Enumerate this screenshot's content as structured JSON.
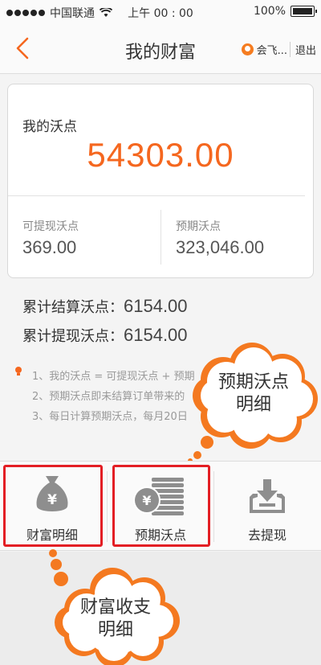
{
  "status_bar": {
    "carrier": "中国联通",
    "time": "上午 00 : 00",
    "battery": "100%"
  },
  "navbar": {
    "title": "我的财富",
    "user_name": "会飞...",
    "logout": "退出"
  },
  "wealth_card": {
    "label": "我的沃点",
    "total": "54303.00",
    "withdrawable_label": "可提现沃点",
    "withdrawable_value": "369.00",
    "expected_label": "预期沃点",
    "expected_value": "323,046.00"
  },
  "stats": {
    "settled_label": "累计结算沃点：",
    "settled_value": "6154.00",
    "withdrawn_label": "累计提现沃点：",
    "withdrawn_value": "6154.00"
  },
  "notes": [
    "1、我的沃点 = 可提现沃点 + 预期",
    "2、预期沃点即未结算订单带来的",
    "3、每日计算预期沃点，每月20日"
  ],
  "tabs": {
    "wealth_detail": "财富明细",
    "expected_points": "预期沃点",
    "withdraw": "去提现"
  },
  "callouts": {
    "top": [
      "预期沃点",
      "明细"
    ],
    "bottom": [
      "财富收支",
      "明细"
    ]
  },
  "colors": {
    "accent": "#f5671f",
    "highlight": "#e31e24",
    "icon_gray": "#8e8e8e"
  }
}
